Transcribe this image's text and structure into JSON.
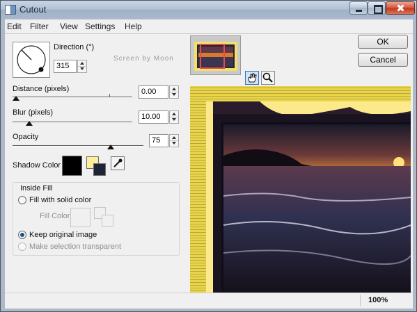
{
  "window": {
    "title": "Cutout"
  },
  "menu": [
    "Edit",
    "Filter",
    "View",
    "Settings",
    "Help"
  ],
  "direction": {
    "label": "Direction (°)",
    "value": "315"
  },
  "watermark": "Screen by Moon",
  "distance": {
    "label": "Distance (pixels)",
    "value": "0.00",
    "level": 0.03
  },
  "blur": {
    "label": "Blur (pixels)",
    "value": "10.00",
    "level": 0.14
  },
  "opacity": {
    "label": "Opacity",
    "value": "75",
    "level": 0.75
  },
  "shadow_color": {
    "label": "Shadow Color",
    "primary": "#000000",
    "fill_swatch": "#ffee99"
  },
  "inside_fill": {
    "group_label": "Inside Fill",
    "solid_label": "Fill with solid color",
    "fill_color_label": "Fill Color",
    "keep_label": "Keep original image",
    "transparent_label": "Make selection transparent",
    "selected": "keep"
  },
  "buttons": {
    "ok": "OK",
    "cancel": "Cancel"
  },
  "status": {
    "zoom": "100%"
  },
  "icons": [
    "window-icon",
    "minimize-icon",
    "maximize-icon",
    "close-icon",
    "pan-hand-icon",
    "zoom-magnifier-icon",
    "eyedropper-icon"
  ],
  "colors": {
    "title_bar": "#b3c2d5",
    "close_button": "#c3361a",
    "preview_border": "#f3e36d"
  }
}
